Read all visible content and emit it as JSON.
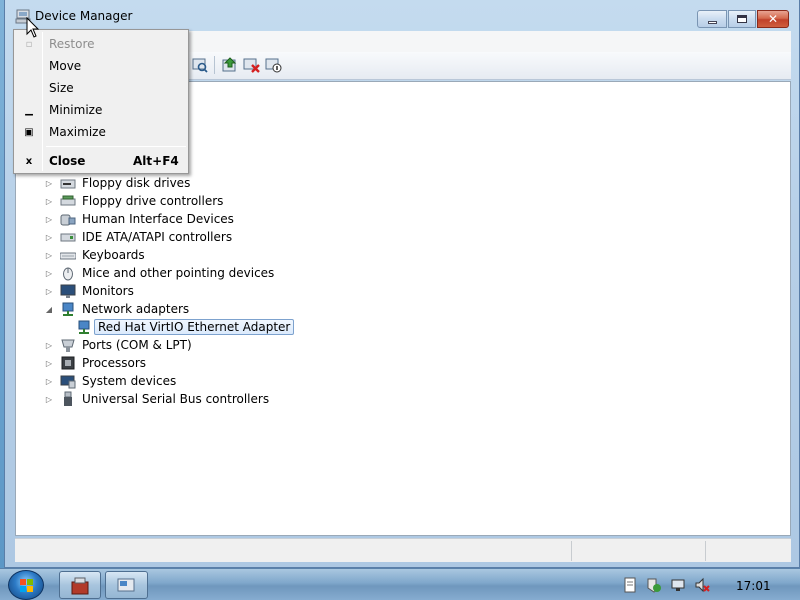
{
  "window": {
    "title": "Device Manager"
  },
  "system_menu": {
    "items": [
      {
        "label": "Restore",
        "glyph": "",
        "disabled": true
      },
      {
        "label": "Move",
        "glyph": "",
        "disabled": false
      },
      {
        "label": "Size",
        "glyph": "",
        "disabled": false
      },
      {
        "label": "Minimize",
        "glyph": "‗",
        "disabled": false
      },
      {
        "label": "Maximize",
        "glyph": "▫",
        "disabled": false
      },
      {
        "label": "Close",
        "glyph": "x",
        "accelerator": "Alt+F4",
        "disabled": false
      }
    ]
  },
  "tree": {
    "items": [
      {
        "label": "Floppy disk drives",
        "icon": "floppy-drive-icon",
        "expanded": false
      },
      {
        "label": "Floppy drive controllers",
        "icon": "controller-icon",
        "expanded": false
      },
      {
        "label": "Human Interface Devices",
        "icon": "hid-icon",
        "expanded": false
      },
      {
        "label": "IDE ATA/ATAPI controllers",
        "icon": "ide-controller-icon",
        "expanded": false
      },
      {
        "label": "Keyboards",
        "icon": "keyboard-icon",
        "expanded": false
      },
      {
        "label": "Mice and other pointing devices",
        "icon": "mouse-icon",
        "expanded": false
      },
      {
        "label": "Monitors",
        "icon": "monitor-icon",
        "expanded": false
      },
      {
        "label": "Network adapters",
        "icon": "network-adapter-icon",
        "expanded": true
      },
      {
        "label": "Red Hat VirtIO Ethernet Adapter",
        "icon": "network-adapter-icon",
        "child": true,
        "selected": true
      },
      {
        "label": "Ports (COM & LPT)",
        "icon": "port-icon",
        "expanded": false
      },
      {
        "label": "Processors",
        "icon": "processor-icon",
        "expanded": false
      },
      {
        "label": "System devices",
        "icon": "system-device-icon",
        "expanded": false
      },
      {
        "label": "Universal Serial Bus controllers",
        "icon": "usb-icon",
        "expanded": false
      }
    ]
  },
  "taskbar": {
    "clock": "17:01"
  },
  "colors": {
    "selection_border": "#7da2ce",
    "selection_fill": "#dbeafc",
    "close_button": "#c0412a"
  }
}
